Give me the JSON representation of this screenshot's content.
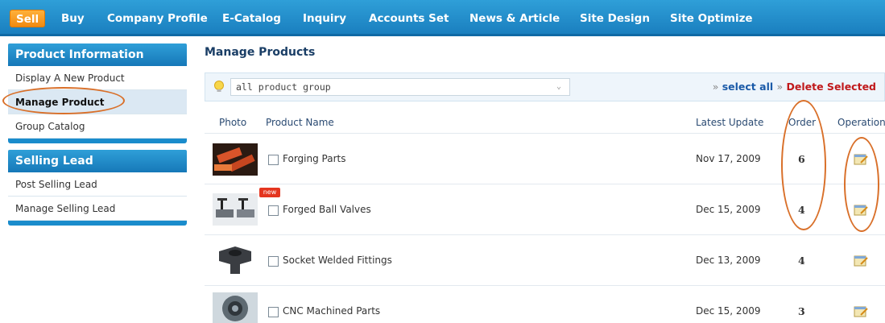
{
  "topnav": {
    "tabs": [
      {
        "label": "Sell",
        "active": true
      },
      {
        "label": "Buy"
      },
      {
        "label": "Company Profile"
      },
      {
        "label": "E-Catalog"
      },
      {
        "label": "Inquiry"
      },
      {
        "label": "Accounts Set"
      },
      {
        "label": "News & Article"
      },
      {
        "label": "Site Design"
      },
      {
        "label": "Site Optimize"
      }
    ]
  },
  "sidebar": {
    "product_info": {
      "title": "Product Information",
      "items": [
        "Display A New Product",
        "Manage Product",
        "Group Catalog"
      ],
      "selected": "Manage Product"
    },
    "selling_lead": {
      "title": "Selling Lead",
      "items": [
        "Post Selling Lead",
        "Manage Selling Lead"
      ]
    }
  },
  "main": {
    "title": "Manage Products",
    "filter": {
      "group_select": "all product group"
    },
    "actions": {
      "arrow": "»",
      "select_all": "select all",
      "delete_selected": "Delete Selected"
    },
    "columns": {
      "photo": "Photo",
      "name": "Product Name",
      "updated": "Latest Update",
      "order": "Order",
      "operation": "Operation"
    },
    "new_badge": "new",
    "products": [
      {
        "name": "Forging Parts",
        "updated": "Nov 17, 2009",
        "order": "6"
      },
      {
        "name": "Forged Ball Valves",
        "updated": "Dec 15, 2009",
        "order": "4"
      },
      {
        "name": "Socket Welded Fittings",
        "updated": "Dec 13, 2009",
        "order": "4"
      },
      {
        "name": "CNC Machined Parts",
        "updated": "Dec 15, 2009",
        "order": "3"
      }
    ]
  },
  "colors": {
    "nav_blue": "#1f8fd0",
    "active_orange": "#f5a020",
    "annotation_orange": "#d9702a",
    "delete_red": "#c0181a"
  },
  "icons": [
    "lightbulb-icon",
    "edit-icon",
    "dropdown-caret-icon"
  ]
}
